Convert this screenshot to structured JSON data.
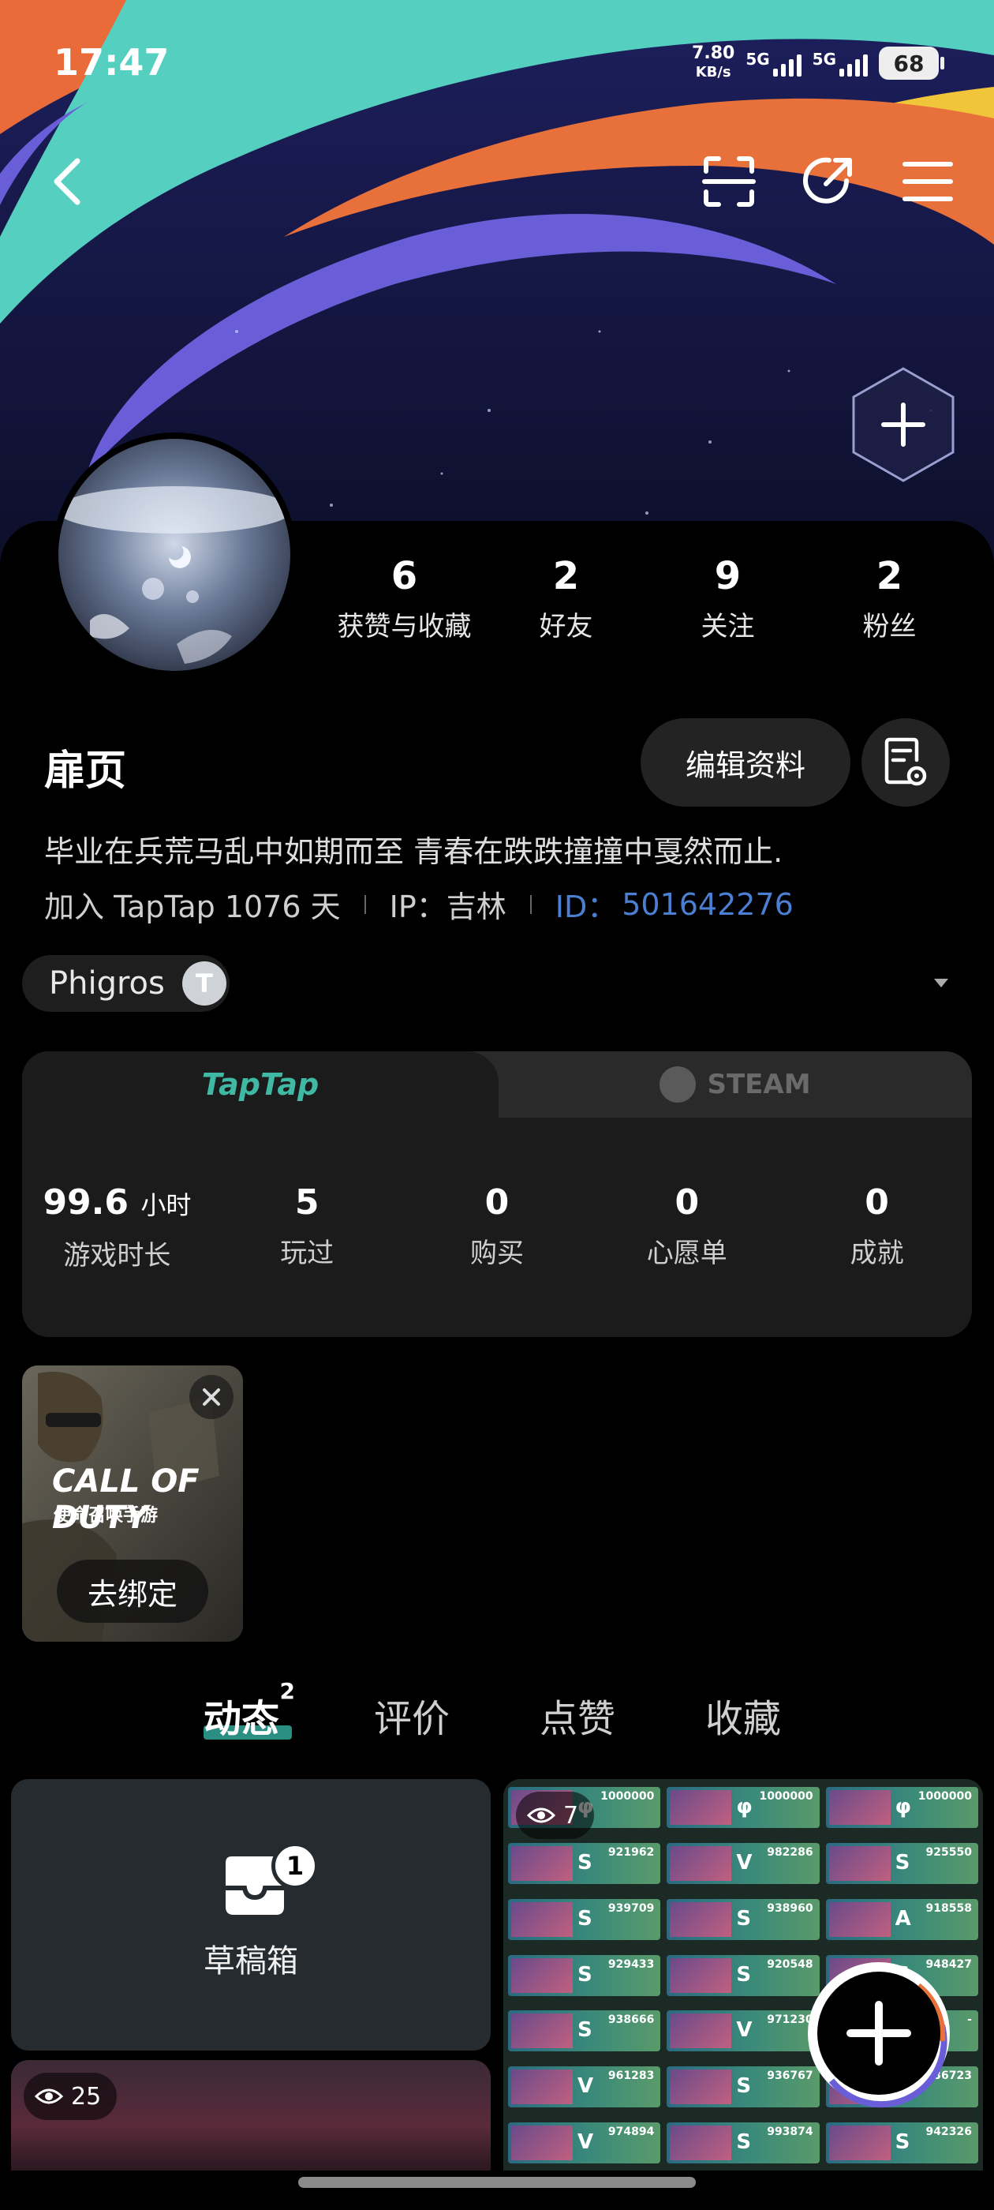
{
  "status_bar": {
    "time": "17:47",
    "net_speed_value": "7.80",
    "net_speed_unit": "KB/s",
    "sim1": "5G",
    "sim2": "5G",
    "battery": "68"
  },
  "header": {
    "back_icon": "chevron-left-icon",
    "scan_icon": "scan-icon",
    "share_icon": "share-icon",
    "menu_icon": "menu-icon",
    "add_icon": "hexagon-plus-icon"
  },
  "profile": {
    "stats": [
      {
        "value": "6",
        "label": "获赞与收藏"
      },
      {
        "value": "2",
        "label": "好友"
      },
      {
        "value": "9",
        "label": "关注"
      },
      {
        "value": "2",
        "label": "粉丝"
      }
    ],
    "username": "扉页",
    "edit_label": "编辑资料",
    "bio": "毕业在兵荒马乱中如期而至 青春在跌跌撞撞中戛然而止.",
    "joined": "加入 TapTap 1076 天",
    "ip": "IP：吉林",
    "id_label": "ID：",
    "id_value": "501642276"
  },
  "game_tag": {
    "name": "Phigros",
    "badge": "T"
  },
  "platform": {
    "tabs": [
      "TapTap",
      "STEAM"
    ],
    "stats": [
      {
        "value": "99.6",
        "unit": "小时",
        "label": "游戏时长"
      },
      {
        "value": "5",
        "label": "玩过"
      },
      {
        "value": "0",
        "label": "购买"
      },
      {
        "value": "0",
        "label": "心愿单"
      },
      {
        "value": "0",
        "label": "成就"
      }
    ]
  },
  "bound_game": {
    "title": "CALL OF DUTY",
    "subtitle": "使命召唤手游",
    "button": "去绑定"
  },
  "content_tabs": [
    {
      "label": "动态",
      "count": "2"
    },
    {
      "label": "评价"
    },
    {
      "label": "点赞"
    },
    {
      "label": "收藏"
    }
  ],
  "feed": {
    "draft_label": "草稿箱",
    "draft_count": "1",
    "post_right_views": "7",
    "post_left_views": "25",
    "scores": [
      "1000000",
      "1000000",
      "1000000",
      "921962",
      "982286",
      "925550",
      "939709",
      "938960",
      "918558",
      "929433",
      "920548",
      "948427",
      "938666",
      "971230",
      "-",
      "961283",
      "936767",
      "936723",
      "974894",
      "993874",
      "942326"
    ],
    "ranks": [
      "φ",
      "φ",
      "φ",
      "S",
      "V",
      "S",
      "S",
      "S",
      "A",
      "S",
      "S",
      "S",
      "S",
      "V",
      "",
      "V",
      "S",
      "S",
      "V",
      "S",
      "S"
    ]
  },
  "colors": {
    "accent_teal": "#3fb8a4",
    "id_blue": "#4b7fd1",
    "card_bg": "#1b1b1b"
  }
}
